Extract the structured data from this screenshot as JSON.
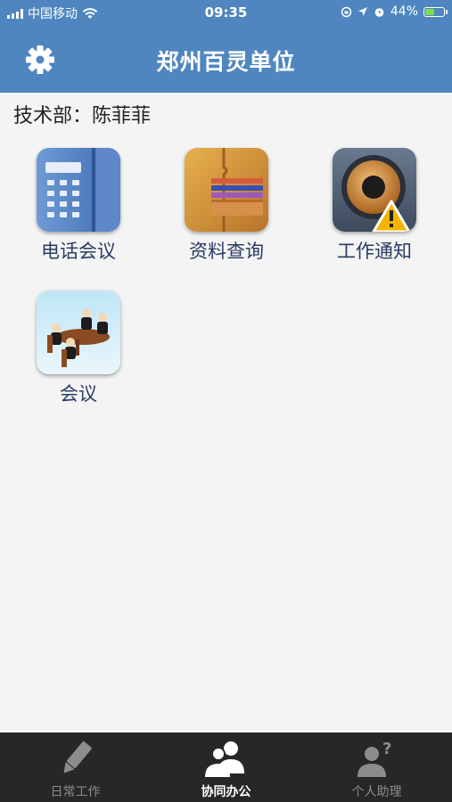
{
  "status_bar": {
    "carrier": "中国移动",
    "time": "09:35",
    "battery": "44%",
    "battery_level": 0.44
  },
  "header": {
    "title": "郑州百灵单位"
  },
  "user_line": "技术部：陈菲菲",
  "apps": [
    {
      "label": "电话会议",
      "icon": "phone-icon"
    },
    {
      "label": "资料查询",
      "icon": "folder-icon"
    },
    {
      "label": "工作通知",
      "icon": "speaker-warning-icon"
    },
    {
      "label": "会议",
      "icon": "meeting-icon"
    }
  ],
  "tabs": [
    {
      "label": "日常工作",
      "icon": "pencil-icon",
      "active": false
    },
    {
      "label": "协同办公",
      "icon": "people-icon",
      "active": true
    },
    {
      "label": "个人助理",
      "icon": "person-question-icon",
      "active": false
    }
  ],
  "colors": {
    "header_blue": "#4f86bf",
    "tab_bar": "#272727",
    "label_text": "#2a3b63"
  }
}
